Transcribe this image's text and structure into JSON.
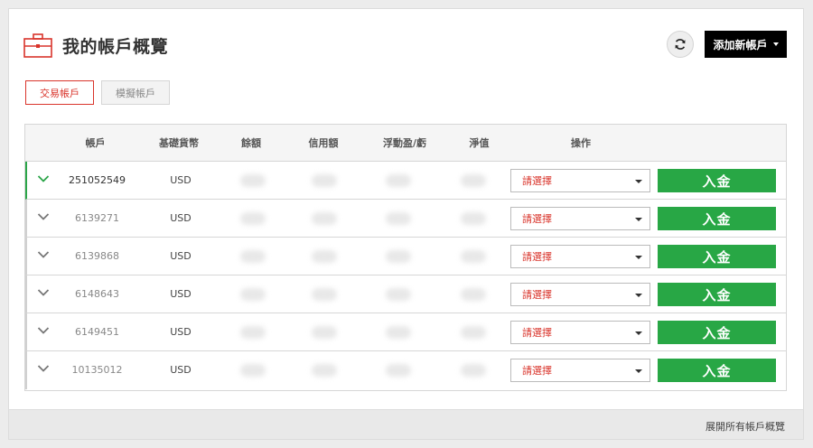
{
  "header": {
    "title": "我的帳戶概覽",
    "add_account_label": "添加新帳戶"
  },
  "tabs": [
    {
      "label": "交易帳戶",
      "active": true
    },
    {
      "label": "模擬帳戶",
      "active": false
    }
  ],
  "table": {
    "columns": [
      "帳戶",
      "基礎貨幣",
      "餘額",
      "信用額",
      "浮動盈/虧",
      "淨值",
      "操作"
    ],
    "rows": [
      {
        "account": "251052549",
        "currency": "USD",
        "action_placeholder": "請選擇",
        "deposit_label": "入金"
      },
      {
        "account": "6139271",
        "currency": "USD",
        "action_placeholder": "請選擇",
        "deposit_label": "入金"
      },
      {
        "account": "6139868",
        "currency": "USD",
        "action_placeholder": "請選擇",
        "deposit_label": "入金"
      },
      {
        "account": "6148643",
        "currency": "USD",
        "action_placeholder": "請選擇",
        "deposit_label": "入金"
      },
      {
        "account": "6149451",
        "currency": "USD",
        "action_placeholder": "請選擇",
        "deposit_label": "入金"
      },
      {
        "account": "10135012",
        "currency": "USD",
        "action_placeholder": "請選擇",
        "deposit_label": "入金"
      }
    ]
  },
  "footer": {
    "expand_label": "展開所有帳戶概覽"
  },
  "icons": {
    "title_icon": "briefcase-icon",
    "refresh": "refresh-icon",
    "row_toggle": "chevron-down-icon"
  },
  "colors": {
    "accent_red": "#d9342b",
    "deposit_green": "#28a745",
    "active_row_marker": "#2aa548"
  }
}
